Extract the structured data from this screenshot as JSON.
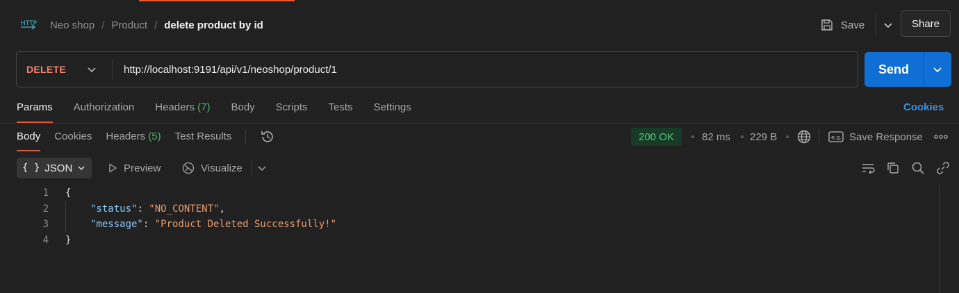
{
  "header": {
    "protocol_icon": "http-icon",
    "breadcrumb": [
      "Neo shop",
      "Product"
    ],
    "breadcrumb_separator": "/",
    "request_name": "delete product by id",
    "save_label": "Save",
    "share_label": "Share"
  },
  "request": {
    "method": "DELETE",
    "url": "http://localhost:9191/api/v1/neoshop/product/1",
    "send_label": "Send"
  },
  "request_tabs": {
    "params": "Params",
    "authorization": "Authorization",
    "headers": "Headers",
    "headers_count": "(7)",
    "body": "Body",
    "scripts": "Scripts",
    "tests": "Tests",
    "settings": "Settings",
    "cookies": "Cookies"
  },
  "response_tabs": {
    "body": "Body",
    "cookies": "Cookies",
    "headers": "Headers",
    "headers_count": "(5)",
    "test_results": "Test Results"
  },
  "response_meta": {
    "status": "200 OK",
    "time": "82 ms",
    "size": "229 B",
    "save_response": "Save Response"
  },
  "format_bar": {
    "format": "JSON",
    "preview": "Preview",
    "visualize": "Visualize"
  },
  "response_body": {
    "line_numbers": [
      "1",
      "2",
      "3",
      "4"
    ],
    "open_brace": "{",
    "close_brace": "}",
    "key1": "\"status\"",
    "value1": "\"NO_CONTENT\"",
    "key2": "\"message\"",
    "value2": "\"Product Deleted Successfully!\""
  },
  "colors": {
    "accent": "#e4572e",
    "send_button": "#0f6fd4",
    "method_delete": "#f0836c",
    "status_ok": "#53c77e",
    "link": "#3d8fe0"
  }
}
